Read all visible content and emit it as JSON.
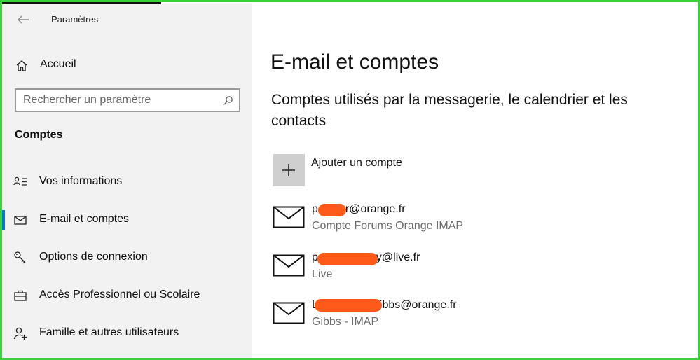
{
  "window": {
    "title": "Paramètres"
  },
  "sidebar": {
    "home_label": "Accueil",
    "search": {
      "placeholder": "Rechercher un paramètre"
    },
    "section_title": "Comptes",
    "items": [
      {
        "label": "Vos informations",
        "icon": "person-info-icon",
        "selected": false
      },
      {
        "label": "E-mail et comptes",
        "icon": "mail-icon",
        "selected": true
      },
      {
        "label": "Options de connexion",
        "icon": "key-icon",
        "selected": false
      },
      {
        "label": "Accès Professionnel ou Scolaire",
        "icon": "briefcase-icon",
        "selected": false
      },
      {
        "label": "Famille et autres utilisateurs",
        "icon": "add-person-icon",
        "selected": false
      }
    ]
  },
  "main": {
    "title": "E-mail et comptes",
    "subtitle": "Comptes utilisés par la messagerie, le calendrier et les contacts",
    "add_account_label": "Ajouter un compte",
    "accounts": [
      {
        "email_prefix": "p",
        "email_suffix": "r@orange.fr",
        "type": "Compte Forums Orange IMAP"
      },
      {
        "email_prefix": "p",
        "email_suffix": "y@live.fr",
        "type": "Live"
      },
      {
        "email_prefix": "L",
        "email_suffix": "ibbs@orange.fr",
        "type": "Gibbs - IMAP"
      }
    ]
  },
  "colors": {
    "accent": "#0078d7",
    "sidebar_bg": "#f2f2f2",
    "redaction": "#ff5a1a",
    "frame": "#3ecf3e"
  }
}
